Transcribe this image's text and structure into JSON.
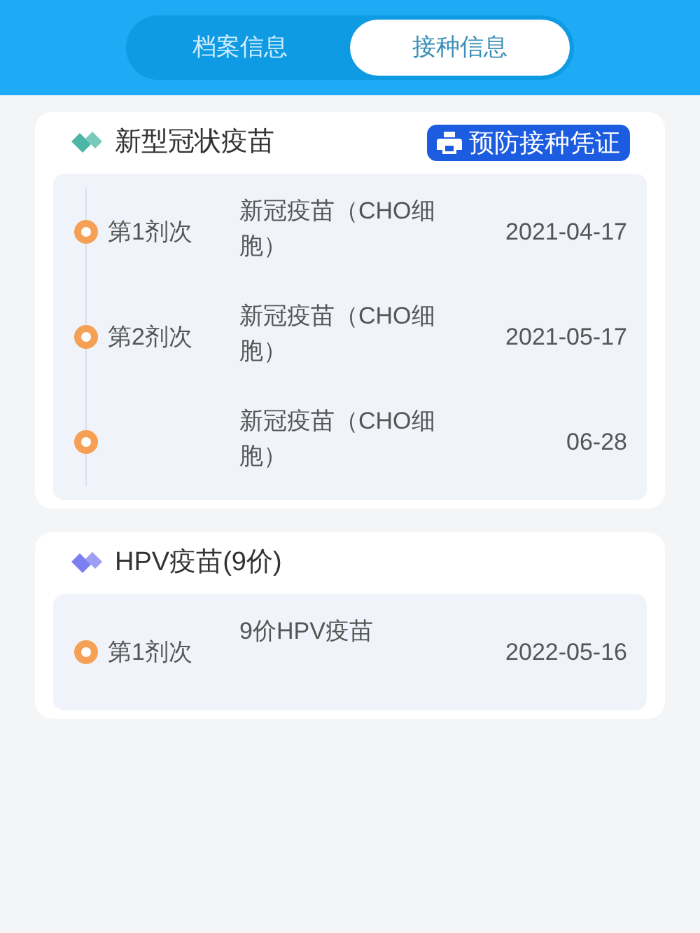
{
  "tabs": [
    {
      "label": "档案信息",
      "selected": false
    },
    {
      "label": "接种信息",
      "selected": true
    }
  ],
  "cards": [
    {
      "title": "新型冠状疫苗",
      "color": "#4cb5a6",
      "button": "预防接种凭证",
      "doses": [
        {
          "dose": "第1剂次",
          "vaccine": "新冠疫苗（CHO细胞）",
          "date": "2021-04-17"
        },
        {
          "dose": "第2剂次",
          "vaccine": "新冠疫苗（CHO细胞）",
          "date": "2021-05-17"
        },
        {
          "vaccine": "新冠疫苗（CHO细胞）",
          "date": "06-28"
        }
      ]
    },
    {
      "title": "HPV疫苗(9价)",
      "color": "#7b7ff0",
      "doses": [
        {
          "dose": "第1剂次",
          "vaccine": "9价HPV疫苗",
          "date": "2022-05-16"
        }
      ]
    }
  ]
}
